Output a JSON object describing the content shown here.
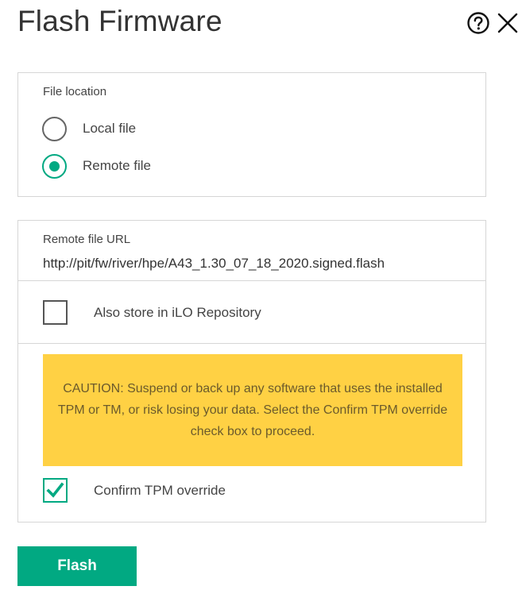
{
  "dialog": {
    "title": "Flash Firmware",
    "help_icon": "question-circle-icon",
    "close_icon": "close-icon"
  },
  "file_location": {
    "label": "File location",
    "options": [
      {
        "label": "Local file",
        "selected": false
      },
      {
        "label": "Remote file",
        "selected": true
      }
    ]
  },
  "remote": {
    "url_label": "Remote file URL",
    "url_value": "http://pit/fw/river/hpe/A43_1.30_07_18_2020.signed.flash",
    "store_label": "Also store in iLO Repository",
    "store_checked": false,
    "caution_text": "CAUTION: Suspend or back up any software that uses the installed TPM or TM, or risk losing your data. Select the Confirm TPM override check box to proceed.",
    "confirm_label": "Confirm TPM override",
    "confirm_checked": true
  },
  "actions": {
    "flash_label": "Flash"
  },
  "colors": {
    "accent": "#01a982",
    "caution_bg": "#ffd144",
    "border": "#d6d6d6"
  }
}
